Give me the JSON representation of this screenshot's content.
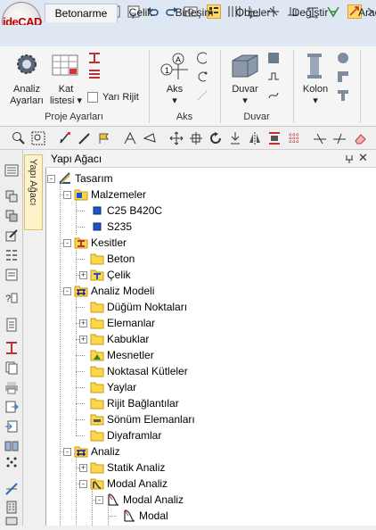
{
  "app": {
    "logo_text": "ideCAD"
  },
  "quick_access": [
    "home-icon",
    "new-file-icon",
    "open-folder-icon",
    "save-icon",
    "save-as-icon",
    "undo-icon",
    "redo-icon",
    "print-preview-icon",
    "select-icon",
    "grid-icon",
    "axis-icon",
    "snap-icon",
    "layer-icon",
    "ortho-icon",
    "dimension-icon",
    "active-snap-icon"
  ],
  "tabs": [
    "Betonarme",
    "Çelik",
    "Birleşim",
    "Objeler",
    "Değiştir",
    "Arac"
  ],
  "ribbon": {
    "proje": {
      "analiz": "Analiz",
      "ayarlari": "Ayarları",
      "kat": "Kat",
      "listesi": "listesi",
      "yari_rijit": "Yarı Rijit",
      "group_label": "Proje Ayarları"
    },
    "aks": {
      "label": "Aks",
      "group_label": "Aks"
    },
    "duvar": {
      "label": "Duvar",
      "group_label": "Duvar"
    },
    "kolon": {
      "label": "Kolon"
    }
  },
  "panel": {
    "title": "Yapı Ağacı",
    "side_tab": "Yapı Ağacı",
    "pin": "ᵖ",
    "close": "✕"
  },
  "tree": [
    {
      "label": "Tasarım",
      "icon": "design-icon"
    },
    {
      "label": "Malzemeler",
      "icon": "materials-icon"
    },
    {
      "label": "C25 B420C",
      "icon": "material-icon"
    },
    {
      "label": "S235",
      "icon": "material-icon"
    },
    {
      "label": "Kesitler",
      "icon": "sections-icon"
    },
    {
      "label": "Beton",
      "icon": "folder-icon"
    },
    {
      "label": "Çelik",
      "icon": "steel-section-icon"
    },
    {
      "label": "Analiz Modeli",
      "icon": "analysis-model-icon"
    },
    {
      "label": "Düğüm Noktaları",
      "icon": "folder-icon"
    },
    {
      "label": "Elemanlar",
      "icon": "folder-icon"
    },
    {
      "label": "Kabuklar",
      "icon": "folder-icon"
    },
    {
      "label": "Mesnetler",
      "icon": "support-icon"
    },
    {
      "label": "Noktasal Kütleler",
      "icon": "folder-icon"
    },
    {
      "label": "Yaylar",
      "icon": "folder-icon"
    },
    {
      "label": "Rijit Bağlantılar",
      "icon": "folder-icon"
    },
    {
      "label": "Sönüm Elemanları",
      "icon": "damper-icon"
    },
    {
      "label": "Diyaframlar",
      "icon": "folder-icon"
    },
    {
      "label": "Analiz",
      "icon": "analysis-icon"
    },
    {
      "label": "Statik Analiz",
      "icon": "folder-icon"
    },
    {
      "label": "Modal Analiz",
      "icon": "modal-folder-icon"
    },
    {
      "label": "Modal Analiz",
      "icon": "modal-icon"
    },
    {
      "label": "Modal",
      "icon": "modal-icon"
    }
  ]
}
